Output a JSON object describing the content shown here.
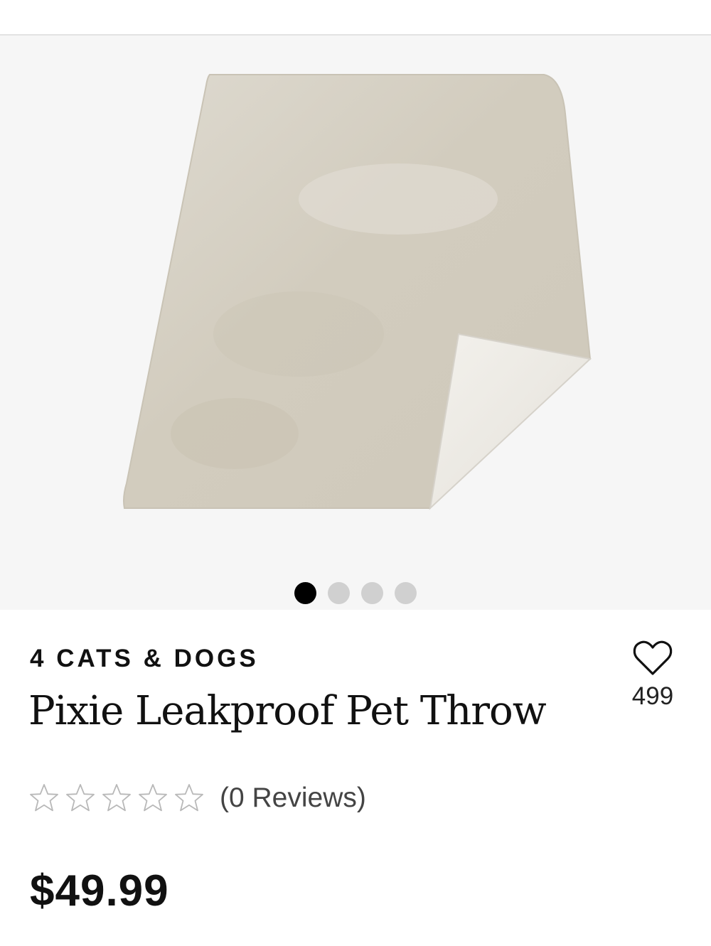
{
  "gallery": {
    "image_alt": "Pixie Leakproof Pet Throw",
    "dot_count": 4,
    "active_dot_index": 0
  },
  "product": {
    "brand": "4 CATS & DOGS",
    "title": "Pixie Leakproof Pet Throw",
    "wishlist_count": "499",
    "rating": 0,
    "rating_max": 5,
    "reviews_label": "(0 Reviews)",
    "price": "$49.99"
  },
  "icons": {
    "wishlist": "heart-outline-icon",
    "rating": "star-outline-icon"
  },
  "colors": {
    "gallery_background": "#f6f6f6",
    "active_dot": "#000000",
    "inactive_dot": "#d0d0d0",
    "throw_fur": "#d6d1c4",
    "throw_underside": "#eeece6"
  }
}
